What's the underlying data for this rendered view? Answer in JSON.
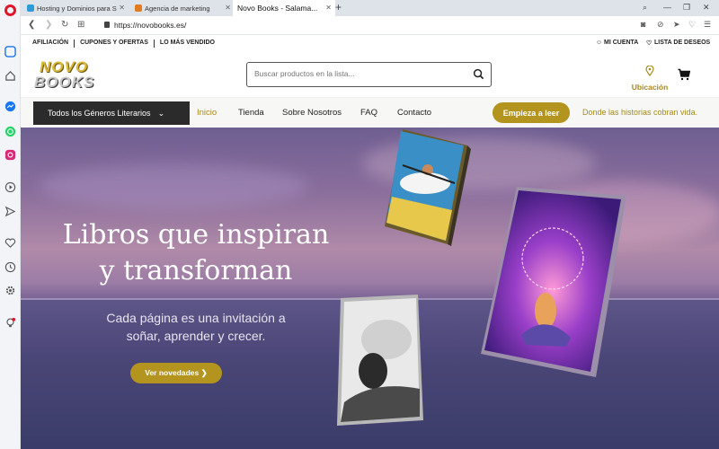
{
  "browser": {
    "tabs": [
      {
        "label": "Hosting y Dominios para S",
        "color": "#2e9bd8"
      },
      {
        "label": "Agencia de marketing",
        "color": "#e07c1f"
      },
      {
        "label": "Novo Books - Salama...",
        "color": ""
      }
    ],
    "new_tab": "+",
    "url": "https://novobooks.es/"
  },
  "site": {
    "top_links": [
      "AFILIACIÓN",
      "CUPONES Y OFERTAS",
      "LO MÁS VENDIDO"
    ],
    "account": "MI CUENTA",
    "wishlist": "LISTA DE DESEOS",
    "logo": {
      "line1": "NOVO",
      "line2": "BOOKS"
    },
    "search_placeholder": "Buscar productos en la lista...",
    "location": "Ubicación",
    "nav": {
      "genres": "Todos los Géneros Literarios",
      "links": [
        "Inicio",
        "Tienda",
        "Sobre Nosotros",
        "FAQ",
        "Contacto"
      ],
      "cta": "Empieza a leer",
      "tagline": "Donde las historias cobran vida."
    },
    "hero": {
      "title_line1": "Libros que inspiran",
      "title_line2": "y transforman",
      "sub_line1": "Cada página es una invitación a",
      "sub_line2": "soñar, aprender y crecer.",
      "button": "Ver novedades ❯"
    }
  },
  "colors": {
    "accent": "#b3941f",
    "opera_red": "#e3172a",
    "dark": "#2b2b2b"
  }
}
